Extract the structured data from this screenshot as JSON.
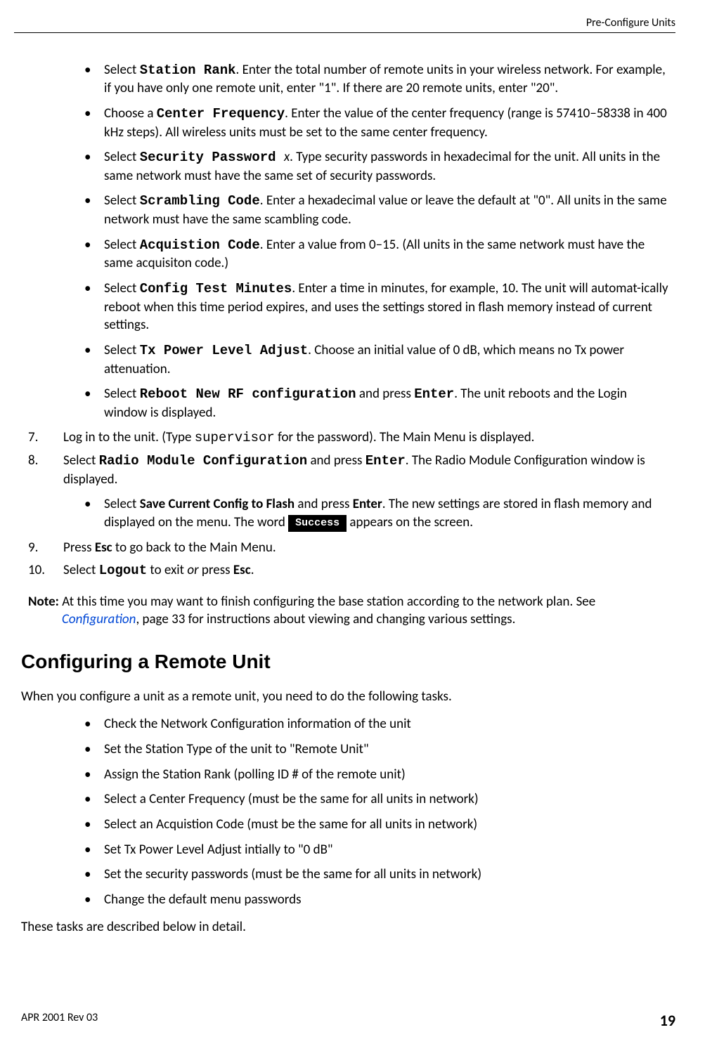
{
  "header": {
    "title": "Pre-Configure Units"
  },
  "bullets_a": [
    {
      "prefix": "Select ",
      "mono": "Station Rank",
      "rest": ". Enter the total number of remote units in your wireless network. For example, if you have only one remote unit, enter \"1\". If there are 20 remote units, enter \"20\"."
    },
    {
      "prefix": "Choose a ",
      "mono": "Center Frequency",
      "rest": ". Enter the value of the center frequency (range is 57410–58338 in 400 kHz steps).  All wireless units must be set to the same center frequency."
    },
    {
      "prefix": "Select ",
      "mono": "Security Password ",
      "midItalic": "x",
      "rest": ". Type security passwords in hexadecimal for the unit. All units in the same network must have the same set of security passwords."
    },
    {
      "prefix": "Select ",
      "mono": "Scrambling Code",
      "rest": ". Enter a hexadecimal value or leave the default at \"0\". All units in the same network must have the same scambling code."
    },
    {
      "prefix": "Select ",
      "mono": "Acquistion Code",
      "rest": ". Enter a value from 0–15. (All units in the same network must have the same acquisiton code.)"
    },
    {
      "prefix": "Select ",
      "mono": "Config Test Minutes",
      "rest": ". Enter a time in minutes, for example, 10. The unit will automat-ically reboot when this time period expires, and uses the settings stored in flash memory instead of current settings."
    },
    {
      "prefix": "Select ",
      "mono": "Tx Power Level Adjust",
      "rest": ". Choose an initial value of 0 dB, which means no Tx power attenuation."
    },
    {
      "prefix": "Select ",
      "mono": "Reboot New RF configuration",
      "mid": " and press ",
      "mono2": "Enter",
      "rest": ". The unit reboots and the Login window is displayed."
    }
  ],
  "step7": {
    "num": "7.",
    "pre": "Log in to the unit. (Type ",
    "mono_plain": "supervisor",
    "post": " for the password). The Main Menu is displayed."
  },
  "step8": {
    "num": "8.",
    "pre": "Select ",
    "mono": "Radio Module Configuration",
    "mid": " and press ",
    "mono2": "Enter",
    "post": ". The Radio Module Configuration window is displayed.",
    "inner": {
      "pre": "Select ",
      "bold1": "Save Current Config to Flash",
      "mid1": " and press ",
      "bold2": "Enter",
      "mid2": ". The new settings are stored in flash memory and displayed on the menu. The word ",
      "success": "Success",
      "post": " appears on the screen."
    }
  },
  "step9": {
    "num": "9.",
    "pre": "Press ",
    "bold": "Esc",
    "post": " to go back to the Main Menu."
  },
  "step10": {
    "num": "10.",
    "pre": "Select ",
    "mono": "Logout",
    "mid": " to exit ",
    "italic": "or",
    "mid2": " press ",
    "bold": "Esc",
    "post": "."
  },
  "note": {
    "label": "Note:",
    "pre": " At this time you may want to finish configuring the base station according to the network plan. See ",
    "link": "Configuration",
    "post": ", page 33 for instructions about viewing and changing various settings."
  },
  "section_title": "Configuring a Remote Unit",
  "intro": "When you configure a unit as a remote unit, you need to do the following tasks.",
  "tasks": [
    "Check the Network Configuration information of the unit",
    "Set the Station Type of the unit to \"Remote Unit\"",
    "Assign the Station Rank (polling ID # of the remote unit)",
    "Select a Center Frequency (must be the same for all units in network)",
    "Select an Acquistion Code (must be the same for all units in network)",
    "Set Tx Power Level Adjust intially to \"0 dB\"",
    "Set the security passwords (must be the same for all units in network)",
    "Change the default menu passwords"
  ],
  "outro": "These tasks are described below in detail.",
  "footer": {
    "left": "APR 2001 Rev 03",
    "right": "19"
  }
}
